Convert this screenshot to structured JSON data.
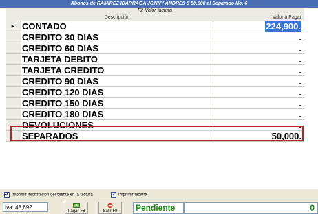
{
  "window": {
    "title": "Abonos de RAMIREZ IDARRAGA JONNY ANDRES $ 50,000 al Separado No. 6"
  },
  "grid": {
    "section_header": "F2-Valor factura",
    "col_descripcion": "Descripción",
    "col_valor": "Valor a Pagar",
    "current_row_marker": "▸",
    "rows": [
      {
        "label": "CONTADO",
        "value": "224,900."
      },
      {
        "label": "CREDITO 30 DIAS",
        "value": "."
      },
      {
        "label": "CREDITO 60 DIAS",
        "value": "."
      },
      {
        "label": "TARJETA DEBITO",
        "value": "."
      },
      {
        "label": "TARJETA CREDITO",
        "value": "."
      },
      {
        "label": "CREDITO 90 DIAS",
        "value": "."
      },
      {
        "label": "CREDITO 120 DIAS",
        "value": "."
      },
      {
        "label": "CREDITO 150 DIAS",
        "value": "."
      },
      {
        "label": "CREDITO 180 DIAS",
        "value": "."
      },
      {
        "label": "DEVOLUCIONES",
        "value": "."
      },
      {
        "label": "SEPARADOS",
        "value": "50,000."
      }
    ]
  },
  "options": {
    "print_client_info_label": "Imprimir información del cliente en la factura",
    "print_invoice_label": "Imprimir factura"
  },
  "footer": {
    "iva_label": "Iva: 43,892",
    "pay_button": "Pagar-F8",
    "exit_button": "Salir-F9",
    "status": "Pendiente",
    "total": "0"
  },
  "icons": {
    "pay": "money-icon",
    "exit": "exit-icon"
  },
  "colors": {
    "title_bar": "#4a6fb5",
    "selection": "#3875d7",
    "highlight_border": "#c0202c",
    "status_text": "#1a8a1a"
  }
}
